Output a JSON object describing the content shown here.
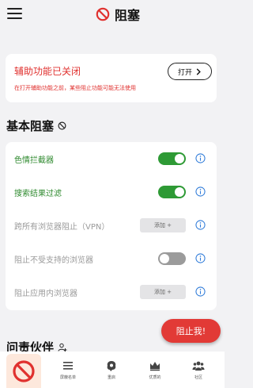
{
  "header": {
    "title": "阻塞"
  },
  "alert": {
    "title": "辅助功能已关闭",
    "description": "在打开辅助功能之前，某些阻止功能可能无法使用",
    "open_button": "打开"
  },
  "basic_block": {
    "section_title": "基本阻塞",
    "rows": [
      {
        "label": "色情拦截器",
        "control": "toggle",
        "state": "on"
      },
      {
        "label": "搜索结果过滤",
        "control": "toggle",
        "state": "on"
      },
      {
        "label": "跨所有浏览器阻止（VPN）",
        "control": "add",
        "button": "添加 +"
      },
      {
        "label": "阻止不受支持的浏览器",
        "control": "toggle",
        "state": "off"
      },
      {
        "label": "阻止应用内浏览器",
        "control": "add",
        "button": "添加 +"
      }
    ]
  },
  "accountability": {
    "section_title": "问责伙伴"
  },
  "fab": {
    "label": "阻止我!"
  },
  "bottom_nav": {
    "items": [
      {
        "label": "",
        "icon": "block-icon"
      },
      {
        "label": "屏蔽名单",
        "icon": "list-icon"
      },
      {
        "label": "重启",
        "icon": "brain-icon"
      },
      {
        "label": "优质的",
        "icon": "crown-icon"
      },
      {
        "label": "社区",
        "icon": "community-icon"
      }
    ]
  },
  "colors": {
    "accent_red": "#e0312f",
    "toggle_on": "#2e9a35",
    "toggle_off": "#9b9b9b",
    "label_green": "#2f8a2f",
    "info_blue": "#2f7bd9"
  }
}
